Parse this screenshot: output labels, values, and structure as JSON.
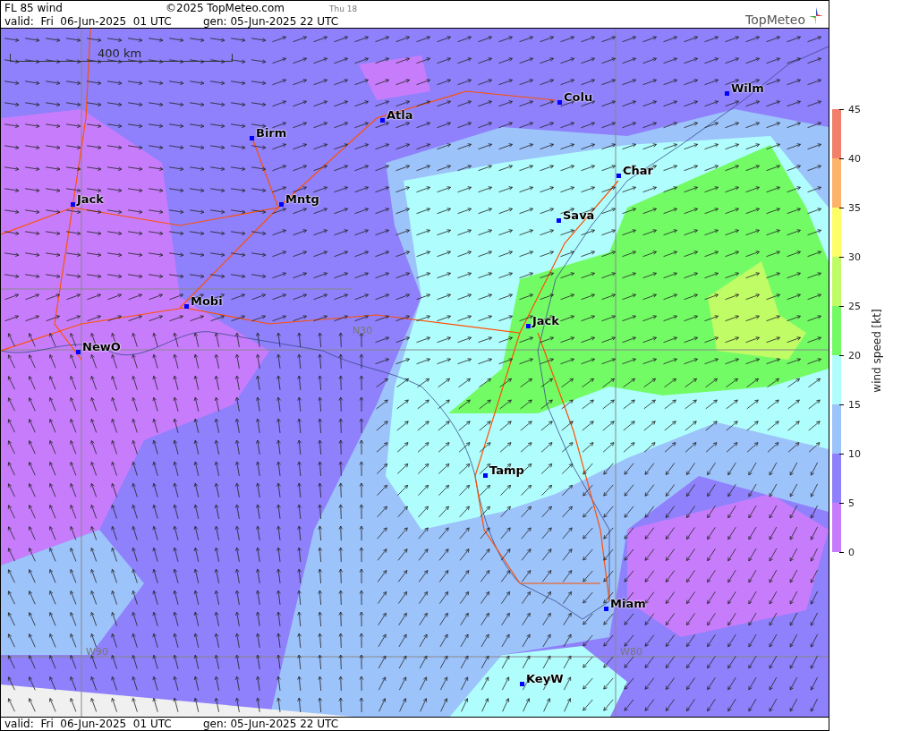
{
  "header": {
    "title": "FL 85 wind",
    "copyright": "©2025 TopMeteo.com",
    "time_tag": "Thu 18",
    "valid": "valid:  Fri  06-Jun-2025  01 UTC",
    "generated": "gen: 05-Jun-2025 22 UTC",
    "logo": "TopMeteo"
  },
  "map": {
    "scale": "400 km",
    "grid_labels": [
      "N30",
      "W90",
      "W80"
    ],
    "cities": [
      {
        "name": "Wilm"
      },
      {
        "name": "Colu"
      },
      {
        "name": "Atla"
      },
      {
        "name": "Birm"
      },
      {
        "name": "Char"
      },
      {
        "name": "Jack"
      },
      {
        "name": "Mntg"
      },
      {
        "name": "Sava"
      },
      {
        "name": "Mobi"
      },
      {
        "name": "Jack"
      },
      {
        "name": "NewO"
      },
      {
        "name": "Tamp"
      },
      {
        "name": "Miam"
      },
      {
        "name": "KeyW"
      }
    ]
  },
  "legend": {
    "title": "wind speed [kt]",
    "ticks": [
      "45",
      "40",
      "35",
      "30",
      "25",
      "20",
      "15",
      "10",
      "5",
      "0"
    ],
    "bands": [
      {
        "color": "#f27f6a"
      },
      {
        "color": "#fdb36a"
      },
      {
        "color": "#fdfd66"
      },
      {
        "color": "#c0fc66"
      },
      {
        "color": "#73fb66"
      },
      {
        "color": "#b0fdfd"
      },
      {
        "color": "#9dc3fb"
      },
      {
        "color": "#8f80fb"
      },
      {
        "color": "#c77dfb"
      }
    ]
  },
  "footer": {
    "valid": "valid:  Fri  06-Jun-2025  01 UTC",
    "generated": "gen: 05-Jun-2025 22 UTC"
  }
}
